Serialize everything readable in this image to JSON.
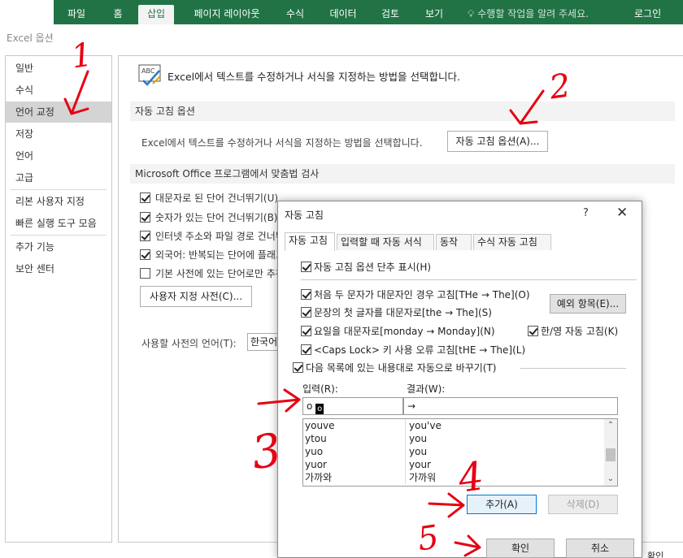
{
  "ribbon": {
    "tabs": [
      "파일",
      "홈",
      "삽입",
      "페이지 레이아웃",
      "수식",
      "데이터",
      "검토",
      "보기"
    ],
    "active_tab": "삽입",
    "tell_me": "수행할 작업을 알려 주세요.",
    "login": "로그인",
    "accent": "#217346"
  },
  "options_window": {
    "title": "Excel 옵션",
    "nav": [
      "일반",
      "수식",
      "언어 교정",
      "저장",
      "언어",
      "고급",
      "리본 사용자 지정",
      "빠른 실행 도구 모음",
      "추가 기능",
      "보안 센터"
    ],
    "active_nav": "언어 교정",
    "intro": "Excel에서 텍스트를 수정하거나 서식을 지정하는 방법을 선택합니다.",
    "autocorrect_section": {
      "heading": "자동 고침 옵션",
      "text": "Excel에서 텍스트를 수정하거나 서식을 지정하는 방법을 선택합니다.",
      "button": "자동 고침 옵션(A)..."
    },
    "spelling_section": {
      "heading": "Microsoft Office 프로그램에서 맞춤법 검사",
      "checks": [
        {
          "label": "대문자로 된 단어 건너뛰기(U)",
          "checked": true
        },
        {
          "label": "숫자가 있는 단어 건너뛰기(B)",
          "checked": true
        },
        {
          "label": "인터넷 주소와 파일 경로 건너뛰기(F)",
          "checked": true
        },
        {
          "label": "외국어: 반복되는 단어에 플래그 지정(R)",
          "checked": true
        },
        {
          "label": "기본 사전에 있는 단어로만 추천(I)",
          "checked": false
        }
      ],
      "custom_dict_button": "사용자 지정 사전(C)...",
      "dict_lang_label": "사용할 사전의 언어(T):",
      "dict_lang_value": "한국어"
    }
  },
  "autocorrect_dialog": {
    "title": "자동 고침",
    "help": "?",
    "close": "✕",
    "tabs": [
      "자동 고침",
      "입력할 때 자동 서식",
      "동작",
      "수식 자동 고침"
    ],
    "active_tab": "자동 고침",
    "show_buttons": {
      "label": "자동 고침 옵션 단추 표시(H)",
      "checked": true
    },
    "options": {
      "two_initial_caps": {
        "label": "처음 두 문자가 대문자인 경우 고침[THe → The](O)",
        "checked": true
      },
      "capitalize_sentence": {
        "label": "문장의 첫 글자를 대문자로[the → The](S)",
        "checked": true
      },
      "capitalize_days": {
        "label": "요일을 대문자로[monday → Monday](N)",
        "checked": true
      },
      "caps_lock": {
        "label": "<Caps Lock> 키 사용 오류 고침[tHE → The](L)",
        "checked": true
      },
      "replace_text": {
        "label": "다음 목록에 있는 내용대로 자동으로 바꾸기(T)",
        "checked": true
      },
      "han_eng": {
        "label": "한/영 자동 고침(K)",
        "checked": true
      }
    },
    "exceptions_button": "예외 항목(E)...",
    "replace_label": "입력(R):",
    "with_label": "결과(W):",
    "replace_value": "o",
    "replace_cursor": "o",
    "with_value": "→",
    "list": [
      {
        "replace": "youve",
        "with": "you've"
      },
      {
        "replace": "ytou",
        "with": "you"
      },
      {
        "replace": "yuo",
        "with": "you"
      },
      {
        "replace": "yuor",
        "with": "your"
      },
      {
        "replace": "가까와",
        "with": "가까워"
      }
    ],
    "add_button": "추가(A)",
    "delete_button": "삭제(D)",
    "ok_button": "확인",
    "cancel_button": "취소",
    "behind_ok": "확인"
  },
  "annotations": {
    "color": "#e60012",
    "numbers": [
      "1",
      "2",
      "3",
      "4",
      "5"
    ]
  }
}
